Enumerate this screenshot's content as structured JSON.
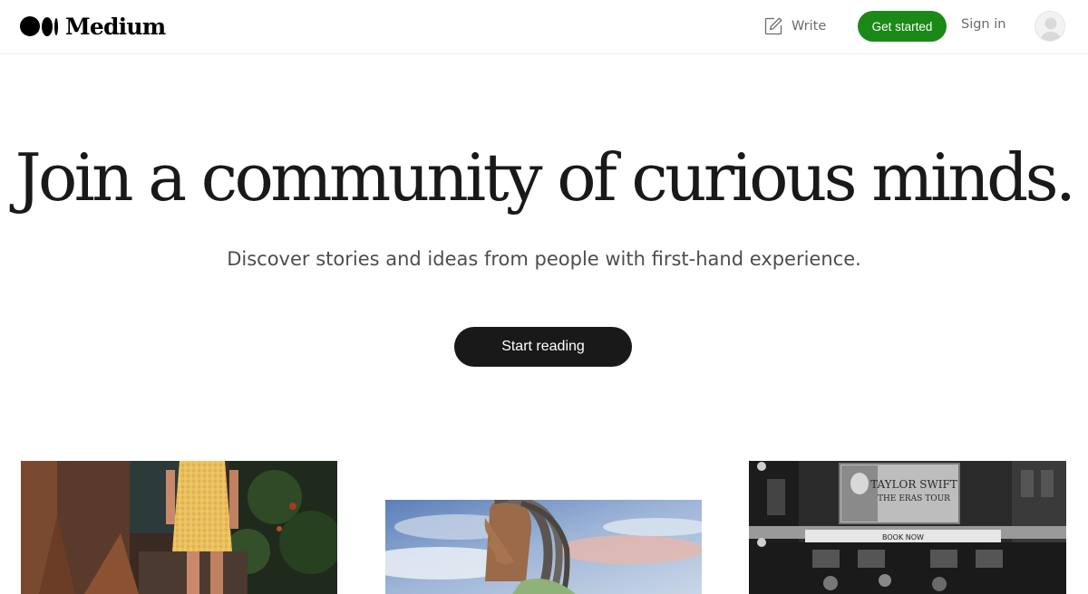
{
  "header": {
    "logo_text": "Medium",
    "write_label": "Write",
    "get_started_label": "Get started",
    "sign_in_label": "Sign in"
  },
  "hero": {
    "title": "Join a community of curious minds.",
    "subtitle": "Discover stories and ideas from people with first-hand experience.",
    "cta_label": "Start reading"
  },
  "images": {
    "billboard_line1": "TAYLOR SWIFT",
    "billboard_line2": "THE ERAS TOUR",
    "marquee_text": "BOOK NOW"
  },
  "colors": {
    "brand_green": "#1a8917",
    "cta_dark": "#191919",
    "muted_text": "#6b6b6b"
  },
  "icons": [
    "medium-logo-icon",
    "write-icon",
    "avatar-user-icon"
  ]
}
